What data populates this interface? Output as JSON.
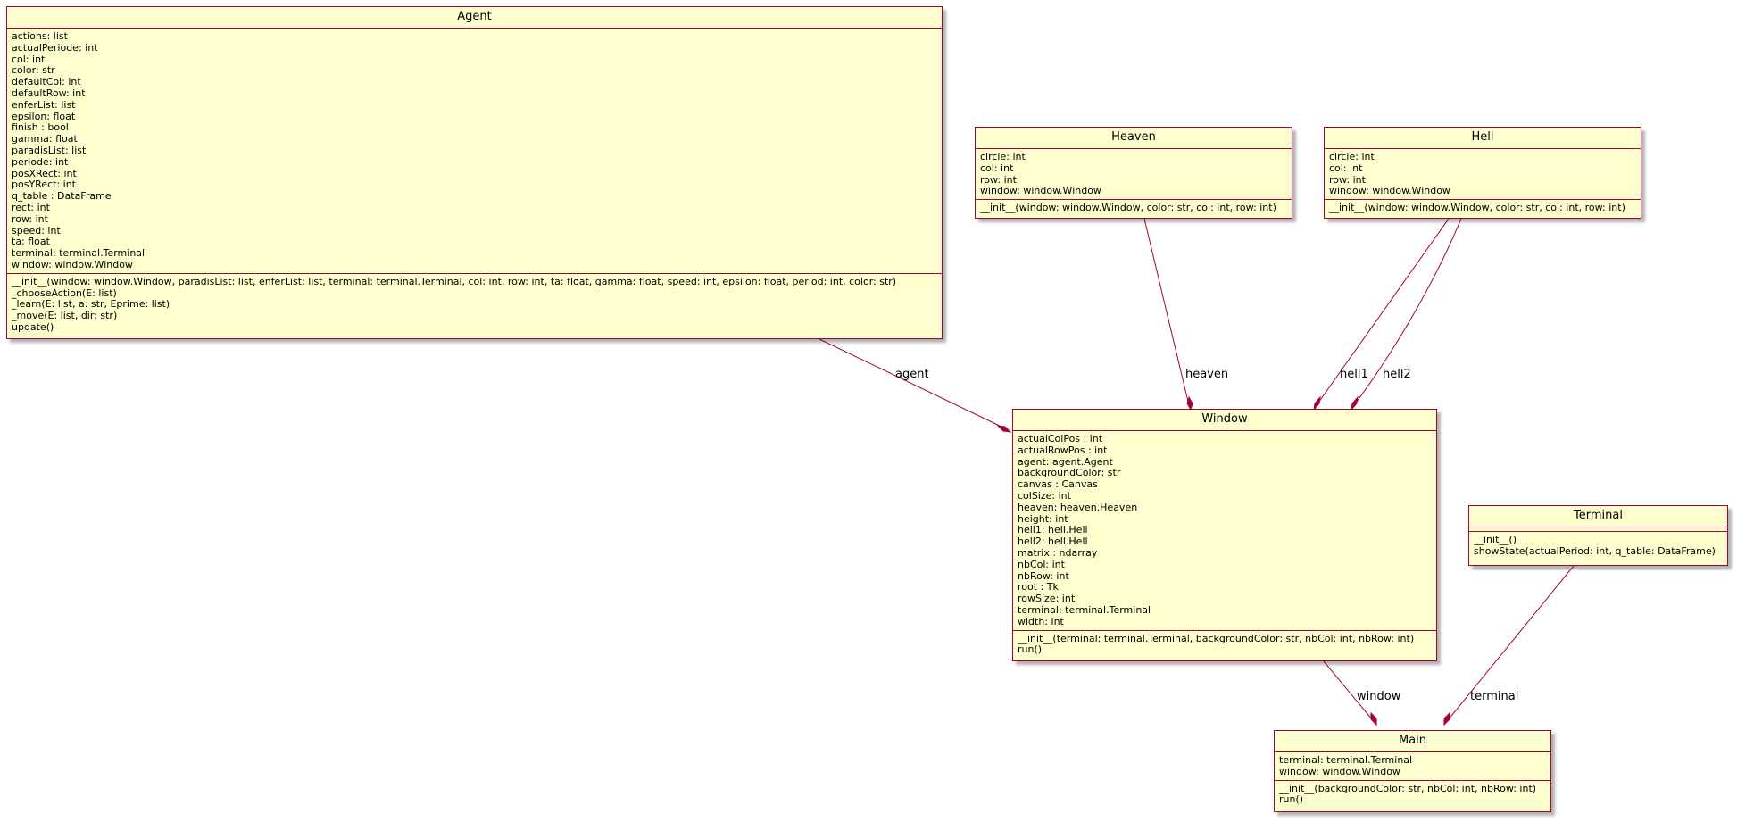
{
  "classes": {
    "agent": {
      "name": "Agent",
      "attributes": [
        "actions: list",
        "actualPeriode: int",
        "col: int",
        "color: str",
        "defaultCol: int",
        "defaultRow: int",
        "enferList: list",
        "epsilon: float",
        "finish : bool",
        "gamma: float",
        "paradisList: list",
        "periode: int",
        "posXRect: int",
        "posYRect: int",
        "q_table : DataFrame",
        "rect: int",
        "row: int",
        "speed: int",
        "ta: float",
        "terminal: terminal.Terminal",
        "window: window.Window"
      ],
      "methods": [
        "__init__(window: window.Window, paradisList: list, enferList: list, terminal: terminal.Terminal, col: int, row: int, ta: float, gamma: float, speed: int, epsilon: float, period: int, color: str)",
        "_chooseAction(E: list)",
        "_learn(E: list, a: str, Eprime: list)",
        "_move(E: list, dir: str)",
        "update()"
      ]
    },
    "heaven": {
      "name": "Heaven",
      "attributes": [
        "circle: int",
        "col: int",
        "row: int",
        "window: window.Window"
      ],
      "methods": [
        "__init__(window: window.Window, color: str, col: int, row: int)"
      ]
    },
    "hell": {
      "name": "Hell",
      "attributes": [
        "circle: int",
        "col: int",
        "row: int",
        "window: window.Window"
      ],
      "methods": [
        "__init__(window: window.Window, color: str, col: int, row: int)"
      ]
    },
    "window": {
      "name": "Window",
      "attributes": [
        "actualColPos : int",
        "actualRowPos : int",
        "agent: agent.Agent",
        "backgroundColor: str",
        "canvas : Canvas",
        "colSize: int",
        "heaven: heaven.Heaven",
        "height: int",
        "hell1: hell.Hell",
        "hell2: hell.Hell",
        "matrix : ndarray",
        "nbCol: int",
        "nbRow: int",
        "root : Tk",
        "rowSize: int",
        "terminal: terminal.Terminal",
        "width: int"
      ],
      "methods": [
        "__init__(terminal: terminal.Terminal, backgroundColor: str, nbCol: int, nbRow: int)",
        "run()"
      ]
    },
    "terminal": {
      "name": "Terminal",
      "attributes": [],
      "methods": [
        "__init__()",
        "showState(actualPeriod: int, q_table: DataFrame)"
      ]
    },
    "main": {
      "name": "Main",
      "attributes": [
        "terminal: terminal.Terminal",
        "window: window.Window"
      ],
      "methods": [
        "__init__(backgroundColor: str, nbCol: int, nbRow: int)",
        "run()"
      ]
    }
  },
  "relations": [
    {
      "from": "Agent",
      "to": "Window",
      "label": "agent",
      "type": "composition"
    },
    {
      "from": "Heaven",
      "to": "Window",
      "label": "heaven",
      "type": "composition"
    },
    {
      "from": "Hell",
      "to": "Window",
      "label": "hell1",
      "type": "composition"
    },
    {
      "from": "Hell",
      "to": "Window",
      "label": "hell2",
      "type": "composition"
    },
    {
      "from": "Window",
      "to": "Main",
      "label": "window",
      "type": "composition"
    },
    {
      "from": "Terminal",
      "to": "Main",
      "label": "terminal",
      "type": "composition"
    }
  ],
  "colors": {
    "class_fill": "#fefece",
    "class_border": "#a80036",
    "edge": "#a80036"
  }
}
